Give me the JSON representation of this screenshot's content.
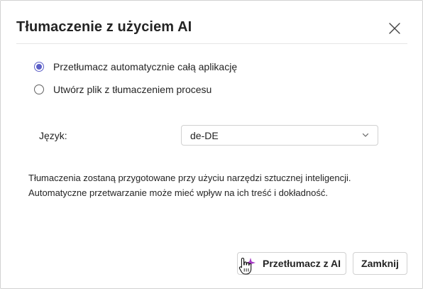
{
  "dialog": {
    "title": "Tłumaczenie z użyciem AI",
    "close_icon": "close-icon"
  },
  "options": [
    {
      "label": "Przetłumacz automatycznie całą aplikację",
      "checked": true
    },
    {
      "label": "Utwórz plik z tłumaczeniem procesu",
      "checked": false
    }
  ],
  "language": {
    "label": "Język:",
    "value": "de-DE"
  },
  "info": {
    "line1": "Tłumaczenia zostaną przygotowane przy użyciu narzędzi sztucznej inteligencji.",
    "line2": "Automatyczne przetwarzanie może mieć wpływ na ich treść i dokładność."
  },
  "buttons": {
    "translate_label": "Przetłumacz z AI",
    "close_label": "Zamknij"
  },
  "colors": {
    "accent": "#5b5fc7",
    "sparkle": "#a53ac4"
  }
}
